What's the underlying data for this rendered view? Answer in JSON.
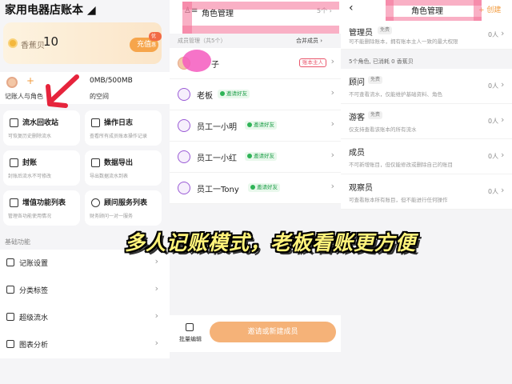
{
  "home": {
    "title": "家用电器店账本",
    "coin_label": "香蕉贝",
    "coin_count": "10",
    "recharge_label": "充值",
    "promo_badge": "优惠",
    "plus": "+",
    "member_label": "记账人与角色",
    "storage": "0MB/500MB",
    "space_label": "的空间",
    "cards": [
      {
        "title": "流水回收站",
        "sub": "可恢复历史删除流水"
      },
      {
        "title": "操作日志",
        "sub": "查看所有成员账本操作记录"
      },
      {
        "title": "封账",
        "sub": "封账后流水不可修改"
      },
      {
        "title": "数据导出",
        "sub": "导出数据流水到表"
      },
      {
        "title": "增值功能列表",
        "sub": "管理各功能使用情况"
      },
      {
        "title": "顾问服务列表",
        "sub": "财务顾问一对一服务"
      }
    ],
    "section_title": "基础功能",
    "features": [
      "记账设置",
      "分类标签",
      "超级流水",
      "图表分析"
    ]
  },
  "roles_page": {
    "title": "角色管理",
    "count": "5个",
    "members_header": "成员管理（共5个）",
    "merge_label": "合并成员",
    "owner_tag": "账本主人",
    "invite_label": "邀请好友",
    "members": [
      {
        "name": "子",
        "tag": "owner"
      },
      {
        "name": "老板",
        "tag": "invite"
      },
      {
        "name": "员工一小明",
        "tag": "invite"
      },
      {
        "name": "员工一小红",
        "tag": "invite"
      },
      {
        "name": "员工一Tony",
        "tag": "invite"
      }
    ],
    "batch_edit": "批量编辑",
    "invite_button": "邀请或新建成员"
  },
  "role_detail": {
    "back": "‹",
    "title": "角色管理",
    "create": "+ 创建",
    "admin": {
      "name": "管理员",
      "tag": "免费",
      "desc": "可不能删除账本，拥有账本主人一致的最大权限",
      "count": "0人"
    },
    "summary": "5个角色, 已消耗 0 香蕉贝",
    "roles": [
      {
        "name": "顾问",
        "tag": "免费",
        "desc": "不可查看流水，仅能维护基础资料、角色",
        "count": "0人"
      },
      {
        "name": "游客",
        "tag": "免费",
        "desc": "仅支持查看该账本的所有流水",
        "count": "0人"
      },
      {
        "name": "成员",
        "tag": "",
        "desc": "不可新增账目，但仅能修改或删除自己的账目",
        "count": "0人"
      },
      {
        "name": "观察员",
        "tag": "",
        "desc": "可查看账本所有账目，但不能进行任何操作",
        "count": "0人"
      }
    ]
  },
  "caption": {
    "part1": "多人记账模式，",
    "part2": "老板看账更方便"
  },
  "colors": {
    "accent": "#f29a3b",
    "highlight": "#f47096",
    "invite_green": "#2fb457",
    "owner_red": "#e9556b"
  }
}
